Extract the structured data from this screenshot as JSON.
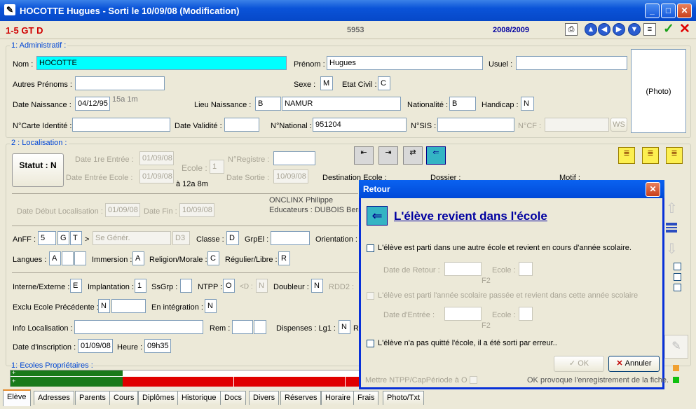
{
  "window": {
    "title": "HOCOTTE Hugues - Sorti le 10/09/08 (Modification)"
  },
  "header": {
    "classe": "1-5 GT D",
    "number": "5953",
    "year": "2008/2009"
  },
  "admin": {
    "section": "1: Administratif :",
    "nom_label": "Nom :",
    "nom": "HOCOTTE",
    "prenom_label": "Prénom :",
    "prenom": "Hugues",
    "usuel_label": "Usuel :",
    "usuel": "",
    "photo": "(Photo)",
    "autres_label": "Autres Prénoms :",
    "autres": "",
    "sexe_label": "Sexe :",
    "sexe": "M",
    "etat_label": "Etat Civil :",
    "etat": "C",
    "dob_label": "Date Naissance :",
    "dob": "04/12/95",
    "age": "15a 1m",
    "lieu_label": "Lieu Naissance :",
    "lieu_code": "B",
    "lieu": "NAMUR",
    "nat_label": "Nationalité :",
    "nat": "B",
    "handicap_label": "Handicap :",
    "handicap": "N",
    "carte_label": "N°Carte Identité :",
    "carte": "",
    "validite_label": "Date Validité :",
    "validite": "",
    "national_label": "N°National :",
    "national": "951204",
    "sis_label": "N°SIS :",
    "sis": "",
    "cf_label": "N°CF :",
    "cf": "",
    "ws": "WS"
  },
  "loc": {
    "section": "2 : Localisation :",
    "statut": "Statut : N",
    "entree1_label": "Date 1re Entrée :",
    "entree1": "01/09/08",
    "ecole_label": "Ecole :",
    "ecole": "1",
    "registre_label": "N°Registre :",
    "registre": "",
    "entree_ecole_label": "Date Entrée Ecole :",
    "entree_ecole": "01/09/08",
    "duree": "à 12a 8m",
    "sortie_label": "Date Sortie :",
    "sortie": "10/09/08",
    "dest_label": "Destination Ecole :",
    "dossier_label": "Dossier :",
    "motif_label": "Motif :",
    "debut_label": "Date Début Localisation :",
    "debut": "01/09/08",
    "fin_label": "Date Fin :",
    "fin": "10/09/08",
    "titulaire": "ONCLINX Philippe",
    "educ": "Educateurs : DUBOIS Bern"
  },
  "school": {
    "anff_label": "AnFF :",
    "anff": "5",
    "anff2": "G",
    "anff3": "T",
    "anff_gt": ">",
    "sgener": "Se Génér.",
    "d3": "D3",
    "classe_label": "Classe :",
    "classe": "D",
    "grpel_label": "GrpEl :",
    "grpel": "",
    "orient_label": "Orientation :",
    "langues_label": "Langues :",
    "langues": "A",
    "immersion_label": "Immersion :",
    "immersion": "A",
    "religion_label": "Religion/Morale :",
    "religion": "C",
    "regulier_label": "Régulier/Libre :",
    "regulier": "R",
    "interne_label": "Interne/Externe :",
    "interne": "E",
    "implant_label": "Implantation :",
    "implant": "1",
    "ssgrp_label": "SsGrp :",
    "ssgrp": "",
    "ntpp_label": "NTPP :",
    "ntpp": "O",
    "d_label": "<D :",
    "d": "N",
    "doubleur_label": "Doubleur :",
    "doubleur": "N",
    "rdd2_label": "RDD2 :",
    "exclu_label": "Exclu Ecole Précédente :",
    "exclu": "N",
    "integ_label": "En intégration :",
    "integ": "N",
    "info_label": "Info Localisation :",
    "info": "",
    "rem_label": "Rem :",
    "disp_label": "Dispenses : Lg1 :",
    "disp": "N",
    "r_label": "R",
    "inscr_label": "Date d'inscription :",
    "inscr": "01/09/08",
    "heure_label": "Heure :",
    "heure": "09h35",
    "proprio_label": "1: Ecoles Propriétaires :"
  },
  "dialog": {
    "title": "Retour",
    "heading": "L'élève revient dans l'école",
    "opt1": "L'élève est parti dans une autre école et revient en cours d'année scolaire.",
    "retour_label": "Date de Retour :",
    "ecole_label": "Ecole :",
    "f2": "F2",
    "opt2": "L'élève est parti l'année scolaire passée et revient dans cette année scolaire",
    "entree_label": "Date d'Entrée :",
    "opt3": "L'élève n'a pas quitté l'école, il a été sorti par erreur..",
    "ok": "OK",
    "annuler": "Annuler",
    "ntpp": "Mettre NTPP/CapPériode à O :",
    "ok_note": "OK provoque l'enregistrement de la fiche."
  },
  "tabs": [
    "Elève",
    "Adresses",
    "Parents",
    "Cours",
    "Diplômes",
    "Historique",
    "Docs",
    "Divers",
    "Réserves",
    "Horaire",
    "Frais",
    "Photo/Txt"
  ],
  "colors": {
    "accent": "#0a53d8",
    "red": "#e00000",
    "green": "#1a7a1a",
    "cyan": "#00ffff"
  }
}
